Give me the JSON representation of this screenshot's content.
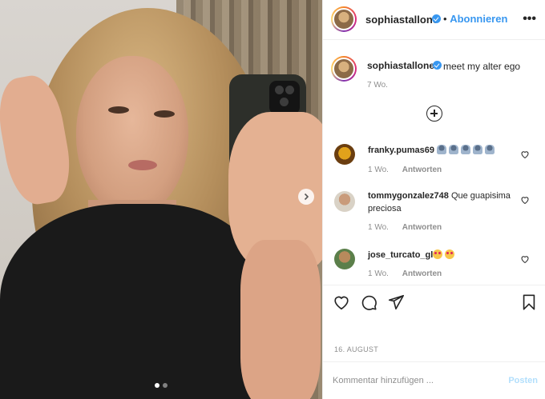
{
  "post": {
    "username": "sophiastallone",
    "separator": "•",
    "follow_label": "Abonnieren",
    "more_icon": "more-horizontal-icon",
    "more_glyph": "•••"
  },
  "caption": {
    "username": "sophiastallone",
    "text": "meet my alter ego",
    "time": "7 Wo."
  },
  "comments": [
    {
      "username": "franky.pumas69",
      "text": "",
      "time": "1 Wo.",
      "reply_label": "Antworten"
    },
    {
      "username": "tommygonzalez748",
      "text": "Que guapisima preciosa",
      "time": "1 Wo.",
      "reply_label": "Antworten"
    },
    {
      "username": "jose_turcato_gl",
      "text": "",
      "time": "1 Wo.",
      "reply_label": "Antworten"
    }
  ],
  "date": "16. AUGUST",
  "comment_box": {
    "placeholder": "Kommentar hinzufügen ...",
    "post_label": "Posten"
  },
  "carousel": {
    "slide_count": 2,
    "current": 1
  },
  "colors": {
    "accent": "#3897f0",
    "text": "#262626",
    "muted": "#8e8e8e",
    "border": "#efefef",
    "post_disabled": "#b2dffc"
  },
  "icons": [
    "verified-badge-icon",
    "add-circle-icon",
    "heart-icon",
    "comment-icon",
    "share-icon",
    "bookmark-icon",
    "next-arrow-icon"
  ]
}
